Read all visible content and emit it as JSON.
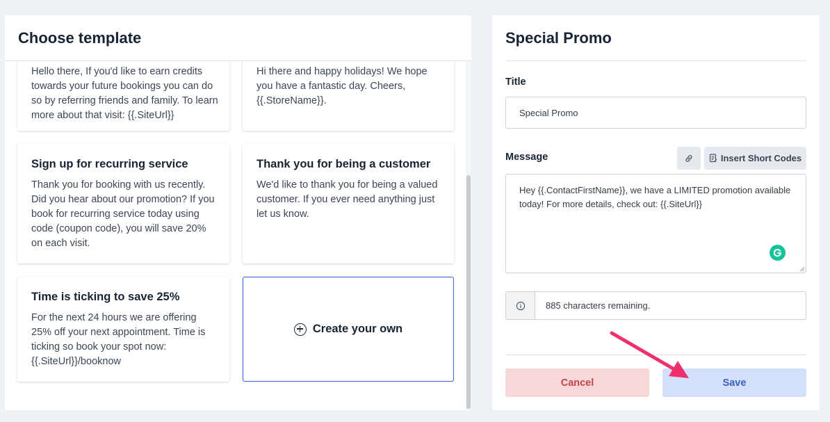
{
  "left_panel": {
    "title": "Choose template",
    "templates": [
      {
        "title": "",
        "body": "Hello there, If you'd like to earn credits towards your future bookings you can do so by referring friends and family. To learn more about that visit: {{.SiteUrl}}"
      },
      {
        "title": "",
        "body": "Hi there and happy holidays! We hope you have a fantastic day. Cheers, {{.StoreName}}."
      },
      {
        "title": "Sign up for recurring service",
        "body": "Thank you for booking with us recently. Did you hear about our promotion? If you book for recurring service today using code (coupon code), you will save 20% on each visit."
      },
      {
        "title": "Thank you for being a customer",
        "body": "We'd like to thank you for being a valued customer. If you ever need anything just let us know."
      },
      {
        "title": "Time is ticking to save 25%",
        "body": "For the next 24 hours we are offering 25% off your next appointment. Time is ticking so book your spot now: {{.SiteUrl}}/booknow"
      }
    ],
    "create_label": "Create your own"
  },
  "right_panel": {
    "title": "Special Promo",
    "title_label": "Title",
    "title_value": "Special Promo",
    "message_label": "Message",
    "insert_short_codes_label": "Insert Short Codes",
    "message_value": "Hey  {{.ContactFirstName}}, we have a LIMITED promotion available today! For more details, check out:  {{.SiteUrl}}",
    "chars_remaining": "885 characters remaining.",
    "cancel_label": "Cancel",
    "save_label": "Save"
  },
  "colors": {
    "accent_blue": "#3b63d6",
    "cancel_bg": "#f8d7d9",
    "cancel_text": "#c4434e",
    "save_bg": "#d4e0fa",
    "save_text": "#3c5ec8",
    "annotation_arrow": "#f0306a"
  },
  "icons": [
    "plus-circle-icon",
    "link-icon",
    "document-icon",
    "info-icon",
    "grammarly-icon",
    "resize-grip-icon"
  ]
}
